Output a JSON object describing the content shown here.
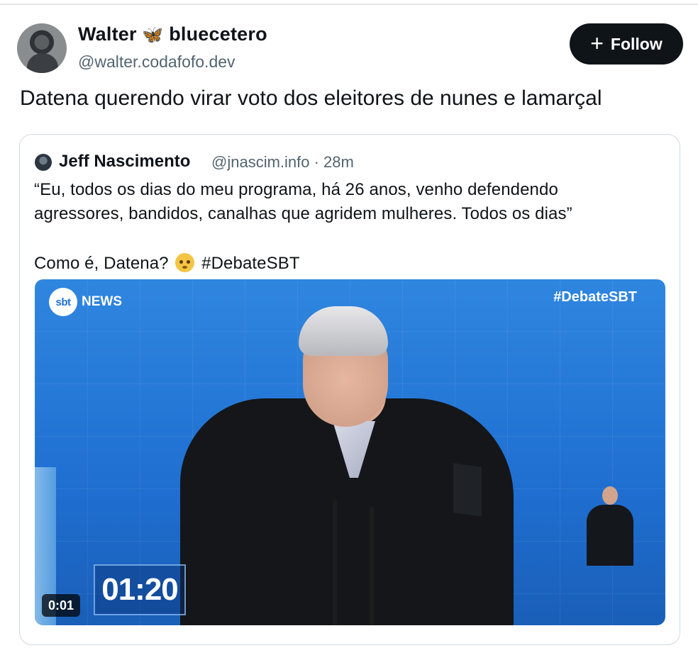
{
  "author": {
    "display_name": "Walter",
    "name_emoji": "🦋",
    "display_name_suffix": "bluecetero",
    "handle": "@walter.codafofo.dev",
    "avatar": "avatar-photo"
  },
  "follow_button": {
    "icon": "plus-icon",
    "label": "Follow"
  },
  "tweet": {
    "text": "Datena querendo virar voto dos eleitores de nunes e lamarçal"
  },
  "quote": {
    "author_name": "Jeff Nascimento",
    "author_meta": "@jnascim.info · 28m",
    "line1": "“Eu, todos os dias do meu programa, há 26 anos, venho defendendo",
    "line2": "agressores, bandidos, canalhas que agridem mulheres. Todos os dias”",
    "line3_prefix": "Como é, Datena?",
    "line3_emoji": "flushed-face",
    "line3_hashtag": "#DebateSBT",
    "video": {
      "logo_text": "sbt",
      "logo_suffix": "NEWS",
      "overlay_hashtag": "#DebateSBT",
      "on_screen_clock": "01:20",
      "timestamp": "0:01"
    }
  },
  "colors": {
    "follow_bg": "#0f1419",
    "video_blue": "#1f6fd1",
    "meta_gray": "#536471"
  }
}
